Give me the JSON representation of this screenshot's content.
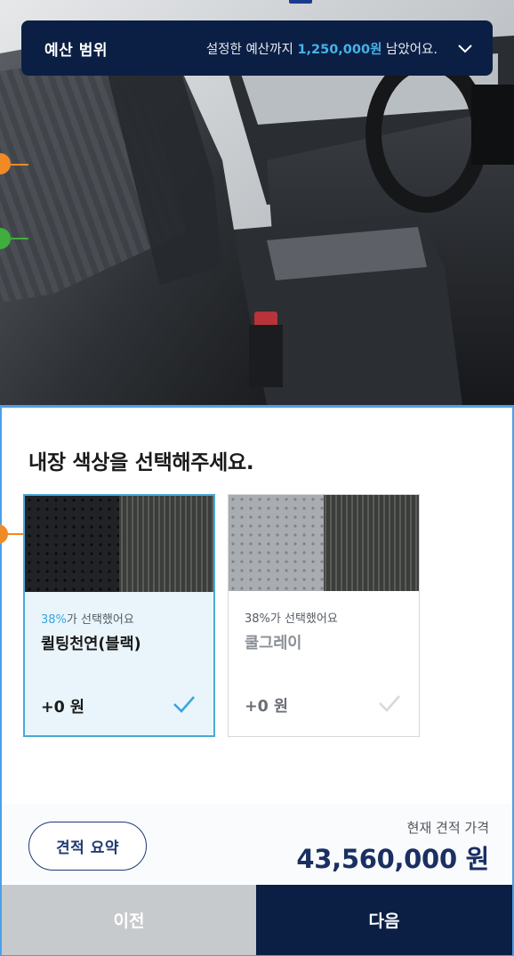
{
  "budget": {
    "title": "예산 범위",
    "prefix": "설정한 예산까지 ",
    "amount": "1,250,000원",
    "suffix": " 남았어요.",
    "expand_icon": "chevron-down-icon"
  },
  "hero": {
    "image": "car-interior-photo"
  },
  "section": {
    "title": "내장 색상을 선택해주세요."
  },
  "options": [
    {
      "pct": "38%",
      "pct_suffix": "가 선택했어요",
      "name": "퀼팅천연(블랙)",
      "price": "+0 원",
      "selected": true
    },
    {
      "pct": "38%",
      "pct_suffix": "가 선택했어요",
      "name": "쿨그레이",
      "price": "+0 원",
      "selected": false
    }
  ],
  "summary": {
    "button_label": "견적 요약",
    "price_label": "현재 견적 가격",
    "price_value": "43,560,000 원"
  },
  "footer": {
    "prev_label": "이전",
    "next_label": "다음"
  },
  "colors": {
    "navy": "#0b1f44",
    "accent": "#47b1e8",
    "selected_border": "#4aa8d8",
    "hotspot_orange": "#f08a24",
    "hotspot_green": "#3fae3f"
  }
}
